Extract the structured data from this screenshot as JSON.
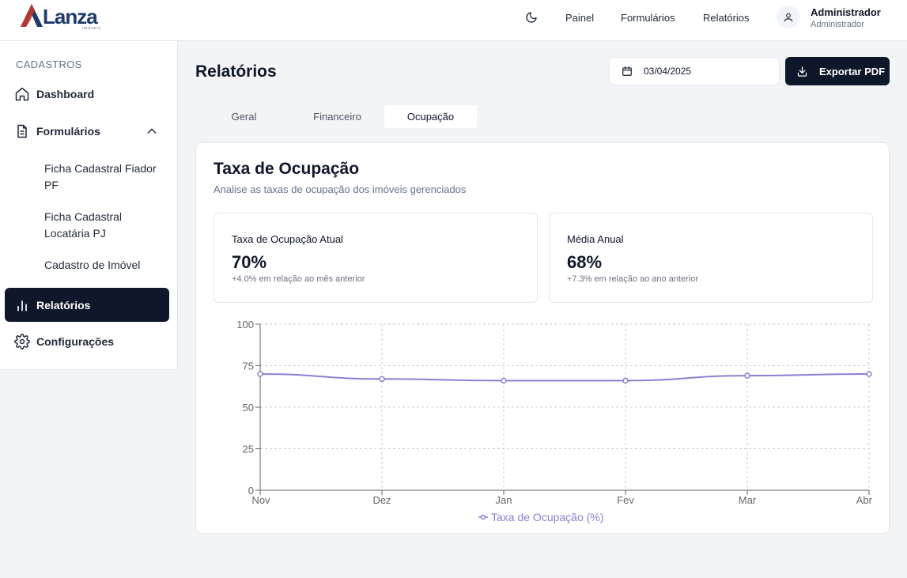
{
  "header": {
    "logo_text": "Lanza",
    "logo_sub": "imóveis",
    "nav": [
      "Painel",
      "Formulários",
      "Relatórios"
    ],
    "user_name": "Administrador",
    "user_role": "Administrador",
    "icons": {
      "theme": "moon-icon",
      "user": "user-icon"
    }
  },
  "sidebar": {
    "section": "CADASTROS",
    "items": {
      "dashboard": "Dashboard",
      "formularios": "Formulários",
      "relatorios": "Relatórios",
      "configuracoes": "Configurações"
    },
    "subitems": [
      "Ficha Cadastral Fiador PF",
      "Ficha Cadastral Locatária PJ",
      "Cadastro de Imóvel"
    ],
    "active": "Relatórios"
  },
  "main": {
    "title": "Relatórios",
    "date": "03/04/2025",
    "export_label": "Exportar PDF",
    "tabs": [
      "Geral",
      "Financeiro",
      "Ocupação"
    ],
    "active_tab": "Ocupação"
  },
  "card": {
    "title": "Taxa de Ocupação",
    "subtitle": "Analise as taxas de ocupação dos imóveis gerenciados",
    "stats": [
      {
        "label": "Taxa de Ocupação Atual",
        "value": "70%",
        "note": "+4.0% em relação ao mês anterior"
      },
      {
        "label": "Média Anual",
        "value": "68%",
        "note": "+7.3% em relação ao ano anterior"
      }
    ]
  },
  "chart_data": {
    "type": "line",
    "categories": [
      "Nov",
      "Dez",
      "Jan",
      "Fev",
      "Mar",
      "Abr"
    ],
    "series": [
      {
        "name": "Taxa de Ocupação (%)",
        "values": [
          70,
          67,
          66,
          66,
          69,
          70
        ],
        "color": "#8b7fd4"
      }
    ],
    "ylim": [
      0,
      100
    ],
    "yticks": [
      0,
      25,
      50,
      75,
      100
    ],
    "grid": true,
    "legend": "bottom"
  },
  "colors": {
    "primary": "#0f172a",
    "accent": "#8b7fd4"
  }
}
